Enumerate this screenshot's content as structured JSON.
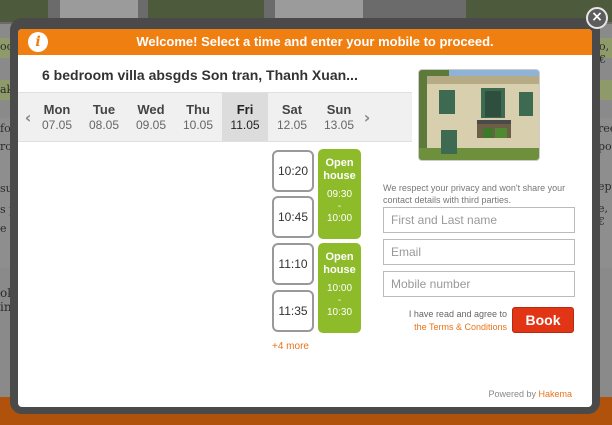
{
  "modal": {
    "close_glyph": "×",
    "header": {
      "info_glyph": "i",
      "title": "Welcome! Select a time and enter your mobile to proceed."
    },
    "property_title": "6 bedroom villa absgds Son tran, Thanh Xuan...",
    "days": [
      {
        "name": "Mon",
        "date": "07.05",
        "active": false
      },
      {
        "name": "Tue",
        "date": "08.05",
        "active": false
      },
      {
        "name": "Wed",
        "date": "09.05",
        "active": false
      },
      {
        "name": "Thu",
        "date": "10.05",
        "active": false
      },
      {
        "name": "Fri",
        "date": "11.05",
        "active": true
      },
      {
        "name": "Sat",
        "date": "12.05",
        "active": false
      },
      {
        "name": "Sun",
        "date": "13.05",
        "active": false
      }
    ],
    "time_slots": [
      "10:20",
      "10:45",
      "11:10",
      "11:35"
    ],
    "open_houses": [
      {
        "label": "Open house",
        "start": "09:30",
        "sep": "-",
        "end": "10:00"
      },
      {
        "label": "Open house",
        "start": "10:00",
        "sep": "-",
        "end": "10:30"
      }
    ],
    "more_link": "+4 more",
    "form": {
      "privacy_note": "We respect your privacy and won't share your contact details with third parties.",
      "name_placeholder": "First and Last name",
      "email_placeholder": "Email",
      "mobile_placeholder": "Mobile number",
      "terms_text": "I have read and agree to",
      "terms_link": "the Terms & Conditions",
      "book_label": "Book"
    },
    "footer": {
      "powered_by": "Powered by",
      "brand": "Hakema"
    }
  },
  "background_page": {
    "fragments": [
      "ood",
      "o,€",
      "ak",
      "ree",
      "pot",
      "for",
      "ept",
      "roo",
      "e,€",
      "sum",
      "s pl",
      "e li",
      "ok",
      "ing"
    ]
  },
  "colors": {
    "header_orange": "#f07f12",
    "open_house_green": "#8dbb2a",
    "book_red": "#e23516",
    "link_orange": "#e8741a"
  }
}
